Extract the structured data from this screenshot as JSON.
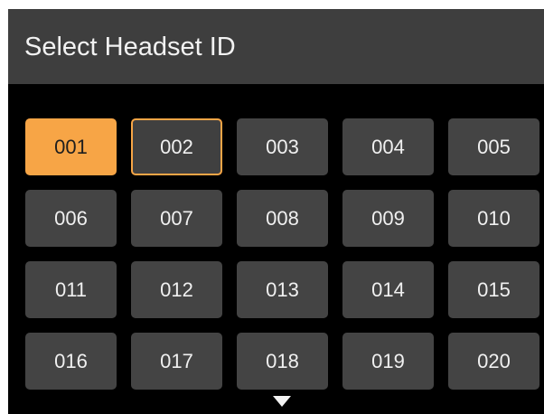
{
  "header": {
    "title": "Select Headset ID"
  },
  "grid": {
    "selected_id": "001",
    "focused_id": "002",
    "ids": [
      "001",
      "002",
      "003",
      "004",
      "005",
      "006",
      "007",
      "008",
      "009",
      "010",
      "011",
      "012",
      "013",
      "014",
      "015",
      "016",
      "017",
      "018",
      "019",
      "020"
    ]
  },
  "colors": {
    "accent": "#f7a546",
    "background": "#000000",
    "header_bg": "#3e3e3e",
    "button_bg": "#444444"
  },
  "icons": {
    "scroll_down": "triangle-down-icon"
  }
}
